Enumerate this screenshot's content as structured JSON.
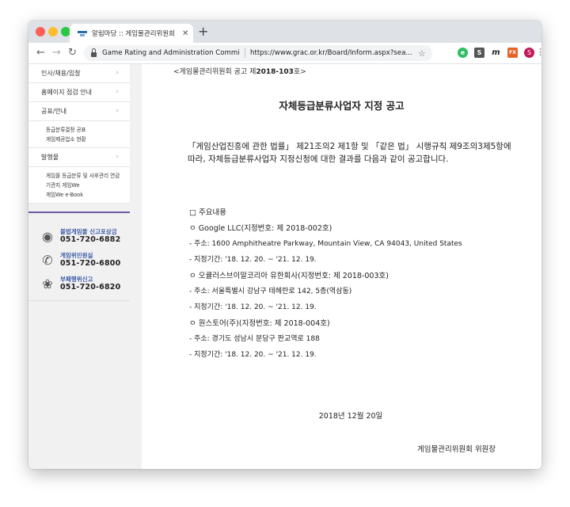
{
  "browser": {
    "tab_title": "알림마당 :: 게임물관리위원회",
    "site_name": "Game Rating and Administration Committee",
    "url": "https://www.grac.or.kr/Board/Inform.aspx?sea..."
  },
  "sidebar": {
    "menu": [
      {
        "label": "인사/채용/입찰"
      },
      {
        "label": "홈페이지 점검 안내"
      },
      {
        "label": "공표/안내"
      }
    ],
    "sub1": [
      "등급분류결정 공표",
      "게임제공업소 현황"
    ],
    "menu2": {
      "label": "발행물"
    },
    "sub2": [
      "게임물 등급분류 및 사후관리 연감",
      "기관지 게임We",
      "게임We e-Book"
    ],
    "contacts": [
      {
        "title": "불법게임물 신고포상금",
        "phone": "051-720-6882"
      },
      {
        "title": "게임위민원실",
        "phone": "051-720-6800"
      },
      {
        "title": "부패행위신고",
        "phone": "051-720-6820"
      }
    ]
  },
  "content": {
    "notice_prefix": "<게임물관리위원회 공고 제",
    "notice_number": "2018-103",
    "notice_suffix": "호>",
    "title": "자체등급분류사업자 지정 공고",
    "intro": "「게임산업진흥에 관한 법률」 제21조의2 제1항 및 「같은 법」 시행규칙 제9조의3제5항에 따라, 자체등급분류사업자 지정신청에 대한 결과를 다음과 같이 공고합니다.",
    "section_heading": "□ 주요내용",
    "lines": [
      "ㅇ Google LLC(지정번호: 제 2018-002호)",
      "- 주소: 1600 Amphitheatre Parkway, Mountain View, CA 94043, United States",
      "- 지정기간: '18. 12. 20. ~ '21. 12. 19.",
      "ㅇ 오큘러스브이알코리아 유한회사(지정번호: 제 2018-003호)",
      "- 주소: 서울특별시 강남구 테헤란로 142, 5층(역삼동)",
      "- 지정기간: '18. 12. 20. ~ '21. 12. 19.",
      "ㅇ 원스토어(주)(지정번호: 제 2018-004호)",
      "- 주소: 경기도 성남시 분당구 판교역로 188",
      "- 지정기간: '18. 12. 20. ~ '21. 12. 19."
    ],
    "date": "2018년 12월 20일",
    "signer": "게임물관리위원회 위원장"
  }
}
